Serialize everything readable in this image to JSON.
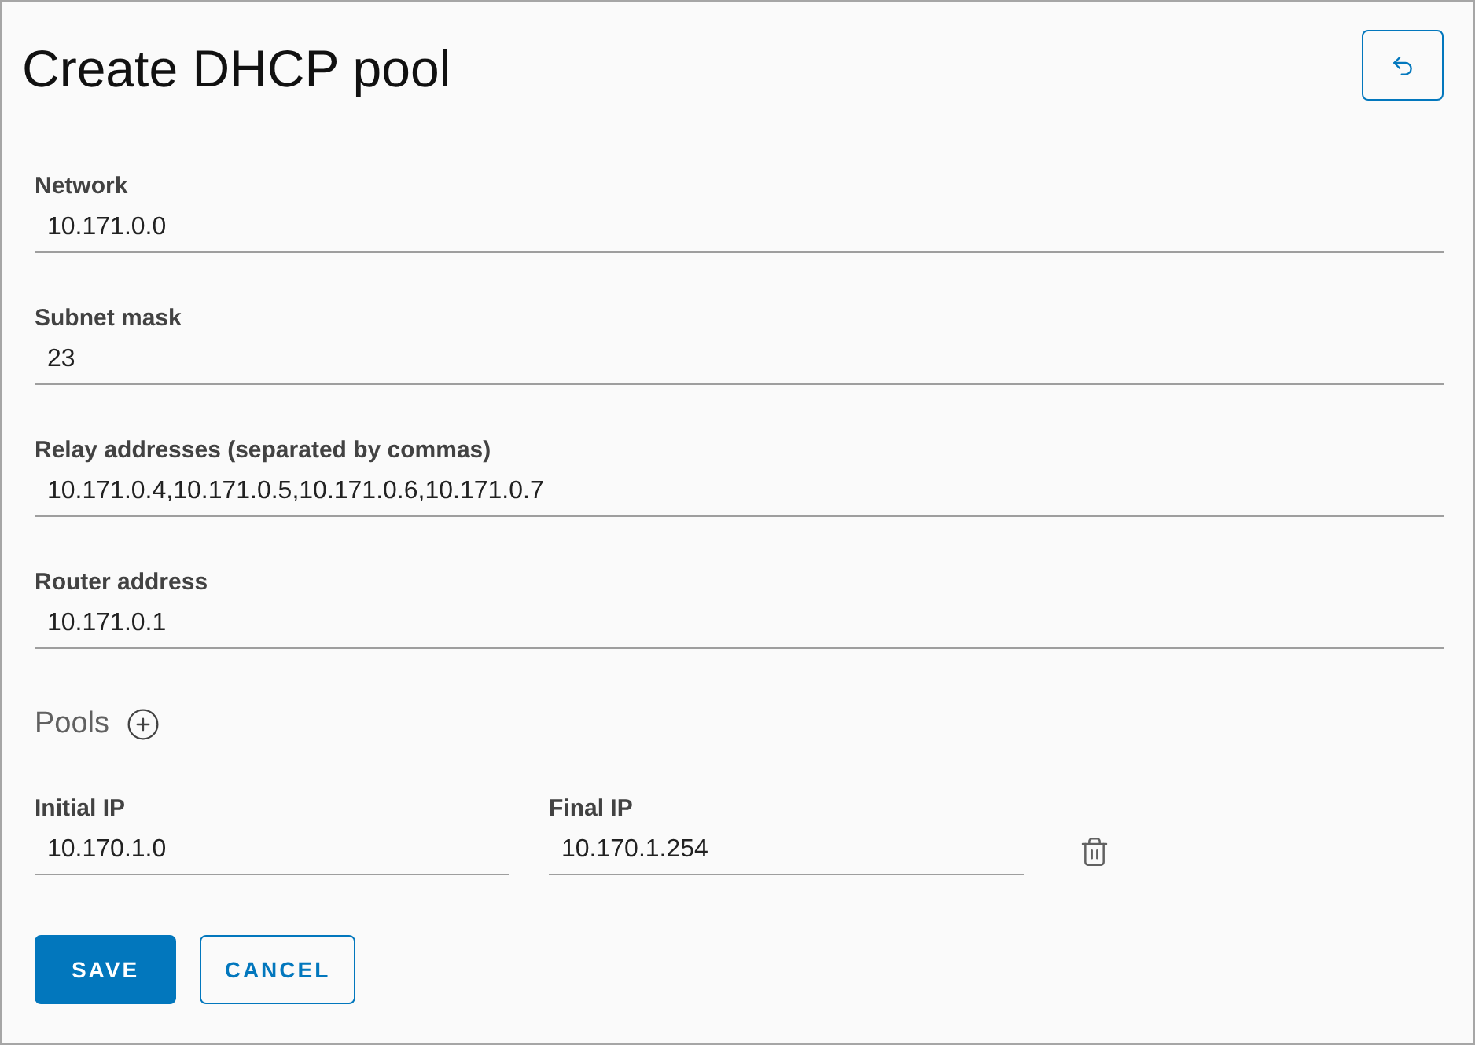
{
  "title": "Create DHCP pool",
  "fields": [
    {
      "label": "Network",
      "value": "10.171.0.0"
    },
    {
      "label": "Subnet mask",
      "value": "23"
    },
    {
      "label": "Relay addresses (separated by commas)",
      "value": "10.171.0.4,10.171.0.5,10.171.0.6,10.171.0.7"
    },
    {
      "label": "Router address",
      "value": "10.171.0.1"
    }
  ],
  "pools": {
    "heading": "Pools",
    "rows": [
      {
        "fields": [
          {
            "label": "Initial IP",
            "value": "10.170.1.0"
          },
          {
            "label": "Final IP",
            "value": "10.170.1.254"
          }
        ]
      }
    ]
  },
  "buttons": [
    {
      "label": "SAVE",
      "kind": "primary"
    },
    {
      "label": "CANCEL",
      "kind": "outline"
    }
  ]
}
